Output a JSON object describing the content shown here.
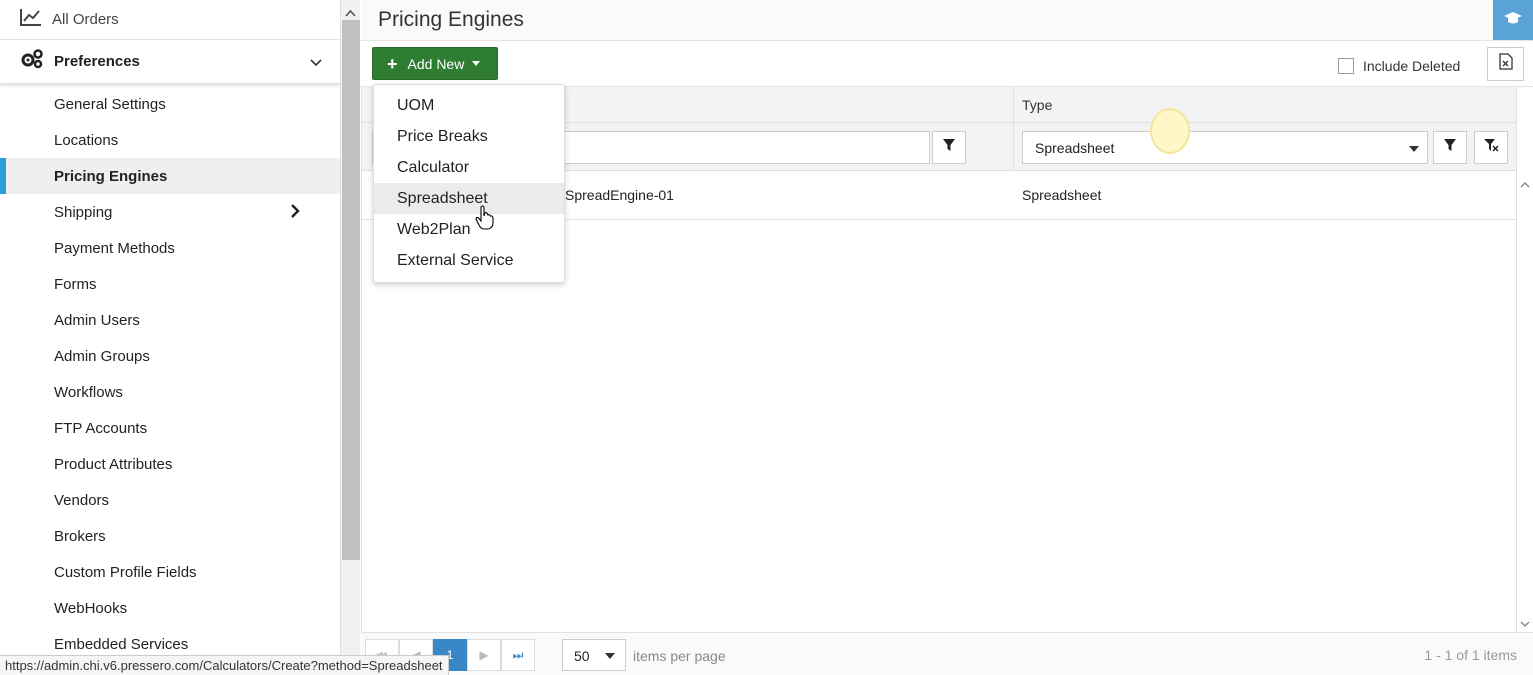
{
  "sidebar": {
    "top_item": {
      "label": "All Orders",
      "icon": "chart-line-icon"
    },
    "section": {
      "label": "Preferences",
      "icon": "gears-icon"
    },
    "items": [
      {
        "label": "General Settings"
      },
      {
        "label": "Locations"
      },
      {
        "label": "Pricing Engines",
        "active": true
      },
      {
        "label": "Shipping",
        "has_submenu": true
      },
      {
        "label": "Payment Methods"
      },
      {
        "label": "Forms"
      },
      {
        "label": "Admin Users"
      },
      {
        "label": "Admin Groups"
      },
      {
        "label": "Workflows"
      },
      {
        "label": "FTP Accounts"
      },
      {
        "label": "Product Attributes"
      },
      {
        "label": "Vendors"
      },
      {
        "label": "Brokers"
      },
      {
        "label": "Custom Profile Fields"
      },
      {
        "label": "WebHooks"
      },
      {
        "label": "Embedded Services"
      }
    ]
  },
  "header": {
    "title": "Pricing Engines",
    "help_icon": "graduation-cap-icon"
  },
  "toolbar": {
    "add_new_label": "Add New",
    "include_deleted_label": "Include Deleted",
    "export_icon": "excel-file-icon"
  },
  "add_menu": {
    "items": [
      "UOM",
      "Price Breaks",
      "Calculator",
      "Spreadsheet",
      "Web2Plan",
      "External Service"
    ],
    "hovered": "Spreadsheet"
  },
  "grid": {
    "columns": {
      "type": "Type"
    },
    "filters": {
      "type_value": "Spreadsheet"
    },
    "rows": [
      {
        "name": "SpreadEngine-01",
        "type": "Spreadsheet"
      }
    ]
  },
  "pager": {
    "current_page": "1",
    "page_size": "50",
    "items_per_page_label": "items per page",
    "info": "1 - 1 of 1 items"
  },
  "status_url": "https://admin.chi.v6.pressero.com/Calculators/Create?method=Spreadsheet",
  "colors": {
    "accent_green": "#2e7d32",
    "active_blue": "#2d9cdb",
    "pager_blue": "#3a87c8",
    "help_blue": "#5aa3d6"
  }
}
